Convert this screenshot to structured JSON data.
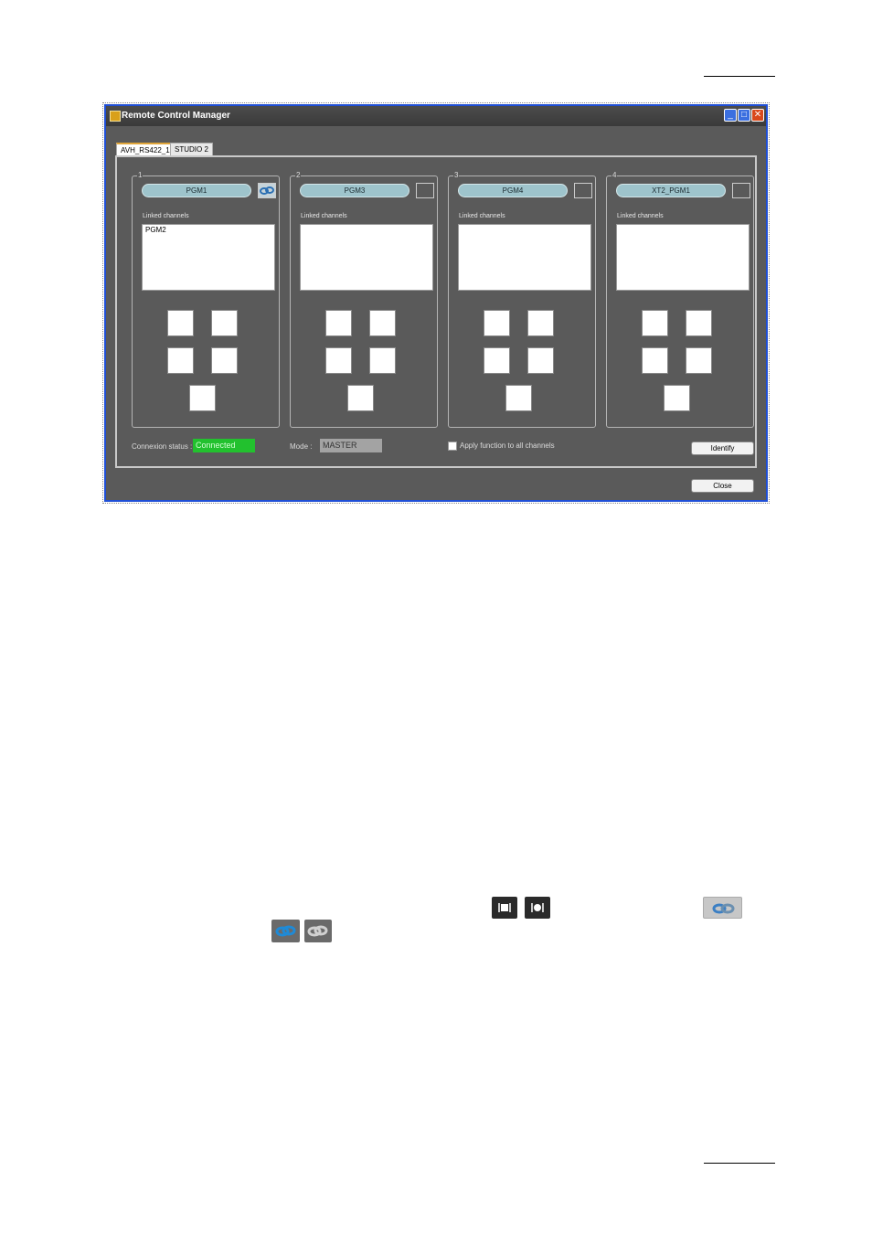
{
  "window": {
    "title": "Remote Control Manager",
    "minimize_glyph": "_",
    "maximize_glyph": "□",
    "close_glyph": "✕"
  },
  "tabs": [
    {
      "label": "AVH_RS422_1",
      "active": true
    },
    {
      "label": "STUDIO 2",
      "active": false
    }
  ],
  "groups": [
    {
      "number": "1",
      "channel": "PGM1",
      "link_icon": "link-icon",
      "linked_label": "Linked channels",
      "linked": [
        "PGM2"
      ]
    },
    {
      "number": "2",
      "channel": "PGM3",
      "linked_label": "Linked channels",
      "linked": []
    },
    {
      "number": "3",
      "channel": "PGM4",
      "linked_label": "Linked channels",
      "linked": []
    },
    {
      "number": "4",
      "channel": "XT2_PGM1",
      "linked_label": "Linked channels",
      "linked": []
    }
  ],
  "footer": {
    "connexion_label": "Connexion status :",
    "connexion_value": "Connected",
    "mode_label": "Mode :",
    "mode_value": "MASTER",
    "apply_label": "Apply function to all channels",
    "identify_label": "Identify",
    "close_label": "Close"
  },
  "colors": {
    "status_connected": "#22c12e",
    "pill": "#9ec4cc",
    "panel": "#5a5a5a",
    "title_accent": "#1f4fd6"
  },
  "inline_icons": [
    "player-icon",
    "record-icon",
    "link-icon-gray",
    "link-icon-blue",
    "link-icon-dark"
  ]
}
